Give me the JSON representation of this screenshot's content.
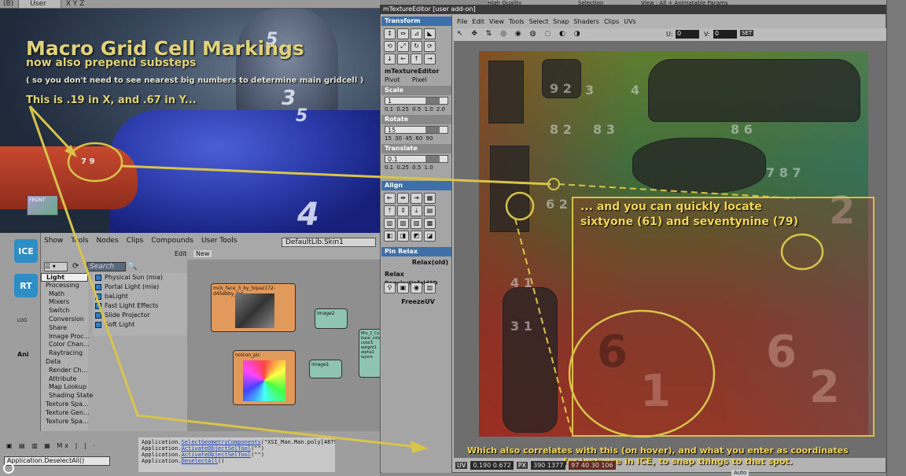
{
  "viewport": {
    "dropdown_label": "User",
    "axis_label": "X Y Z",
    "title_line1": "Macro Grid Cell Markings",
    "title_line2": "now also prepend substeps",
    "title_line3": "( so you don't need to see nearest big numbers to determine main gridcell )",
    "title_line4": "This is .19 in X, and .67 in Y...",
    "front_label": "FRONT",
    "marker_label": "7 9"
  },
  "top_strip": {
    "quality": "High Quality",
    "selection": "Selection",
    "view": "View : All + Animatable Params"
  },
  "ice": {
    "menu": [
      "Show",
      "Tools",
      "Nodes",
      "Clips",
      "Compounds",
      "User Tools"
    ],
    "lib_name": "DefaultLib.Skin1",
    "edit_label": "Edit",
    "new_label": "New",
    "search_placeholder": "Search",
    "side_tabs": [
      "ICE",
      "RT",
      "LOG",
      "Ani"
    ],
    "tree": [
      {
        "label": "Light",
        "selected": true,
        "sub": false
      },
      {
        "label": "Processing",
        "sub": false
      },
      {
        "label": "Math",
        "sub": true
      },
      {
        "label": "Mixers",
        "sub": true
      },
      {
        "label": "Switch",
        "sub": true
      },
      {
        "label": "Conversion",
        "sub": true
      },
      {
        "label": "Share",
        "sub": true
      },
      {
        "label": "Image Proc...",
        "sub": true
      },
      {
        "label": "Color Chan...",
        "sub": true
      },
      {
        "label": "Raytracing",
        "sub": true
      },
      {
        "label": "Data",
        "sub": false
      },
      {
        "label": "Render Ch...",
        "sub": true
      },
      {
        "label": "Attribute",
        "sub": true
      },
      {
        "label": "Map Lookup",
        "sub": true
      },
      {
        "label": "Shading State",
        "sub": true
      },
      {
        "label": "Texture Spa...",
        "sub": false
      },
      {
        "label": "Texture Gen...",
        "sub": false
      },
      {
        "label": "Texture Spa...",
        "sub": false
      }
    ],
    "tools": [
      "Physical Sun (mia)",
      "Portal Light (mia)",
      "baLight",
      "Fast Light Effects",
      "Slide Projector",
      "Soft Light"
    ],
    "nodes": {
      "image_node": "mck_face_3_by_topaz172-d45ebby_jpg",
      "image2": "Image2",
      "image1": "Image1",
      "mix": "Mix_2_Co",
      "nolicon": "noIcon_pic",
      "mix_ports": [
        "base_color",
        "color1",
        "weight1",
        "alpha1",
        "layers"
      ]
    }
  },
  "cmdlog": [
    {
      "prefix": "Application.",
      "link": "SelectGeometryComponents",
      "suffix": "(\"XSI_Man.Man.poly[4879]\")"
    },
    {
      "prefix": "Application.",
      "link": "ActivateObjectSelTool",
      "suffix": "(\"\")"
    },
    {
      "prefix": "Application.",
      "link": "ActivateObjectSelTool",
      "suffix": "(\"\")"
    },
    {
      "prefix": "Application.",
      "link": "DeselectAll",
      "suffix": "()"
    }
  ],
  "deselect_cmd": "Application.DeselectAll()",
  "texture_editor": {
    "title": "mTextureEditor [user add-on]",
    "menu": [
      "File",
      "Edit",
      "View",
      "Tools",
      "Select",
      "Snap",
      "Shaders",
      "Clips",
      "UVs"
    ],
    "u_label": "U:",
    "u_value": "0",
    "v_label": "V:",
    "v_value": "0",
    "set_label": "SET",
    "panel": {
      "transform": "Transform",
      "mtex_label": "mTextureEditor",
      "pivot": "Pivot",
      "pixel": "Pixel",
      "scale": "Scale",
      "scale_value": "1",
      "scale_presets": "0.1 0.25 0.5 1.0 2.0",
      "rotate": "Rotate",
      "rotate_value": "15",
      "rotate_presets": "15 30 45 60 90",
      "translate": "Translate",
      "translate_value": "0.1",
      "translate_presets": "0.1 0.25 0.5 1.0",
      "align": "Align",
      "pin_relax": "Pin Relax",
      "relax_old": "Relax(old)",
      "relax": "Relax",
      "regular_unfold": "RegularUnfold3D",
      "freeze": "FreezeUV"
    },
    "callout_line1": "... and you can quickly locate",
    "callout_line2": "sixtyone (61) and seventynine (79)",
    "bottom_line1": "Which also correlates with this (on hover), and what you enter as coordinates",
    "bottom_line2": "for instance in ICE, to snap things to that spot.",
    "status": {
      "uv_label": "UV",
      "uv_value": "0.190 0.672",
      "px_label": "PX",
      "px_value": "390 1377",
      "color_value": "97 40 30 106"
    },
    "auto_label": "Auto"
  }
}
